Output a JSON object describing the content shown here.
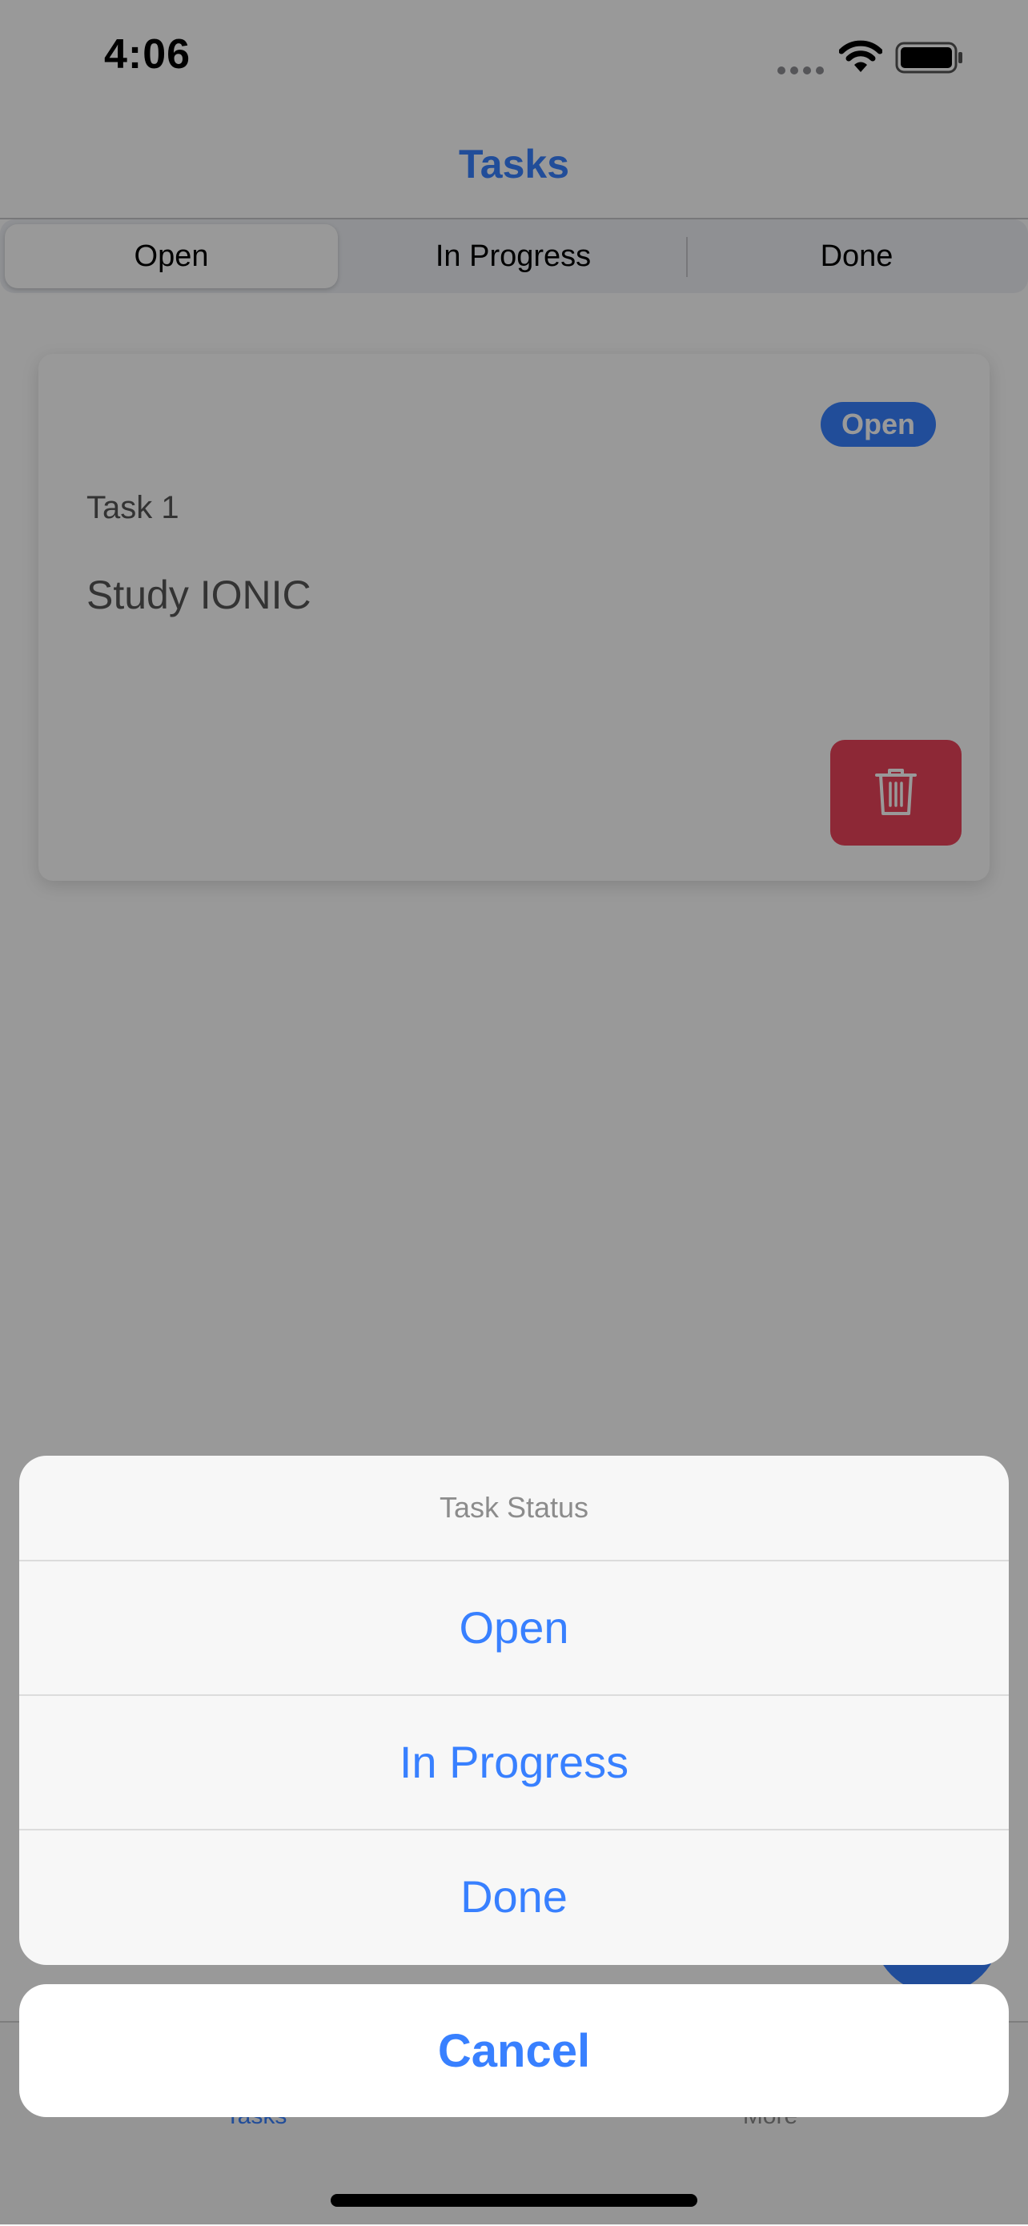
{
  "status_bar": {
    "time": "4:06"
  },
  "header": {
    "title": "Tasks"
  },
  "segment": {
    "items": [
      {
        "label": "Open",
        "selected": true
      },
      {
        "label": "In Progress",
        "selected": false
      },
      {
        "label": "Done",
        "selected": false
      }
    ]
  },
  "task_card": {
    "badge": "Open",
    "subtitle": "Task 1",
    "title": "Study IONIC",
    "delete_icon": "trash-icon"
  },
  "tab_bar": {
    "items": [
      {
        "label": "Tasks",
        "active": true
      },
      {
        "label": "More",
        "active": false
      }
    ]
  },
  "action_sheet": {
    "header": "Task Status",
    "options": [
      "Open",
      "In Progress",
      "Done"
    ],
    "cancel_label": "Cancel"
  },
  "colors": {
    "primary": "#3880ff",
    "danger": "#eb445a",
    "backdrop": "rgba(0,0,0,0.40)"
  }
}
